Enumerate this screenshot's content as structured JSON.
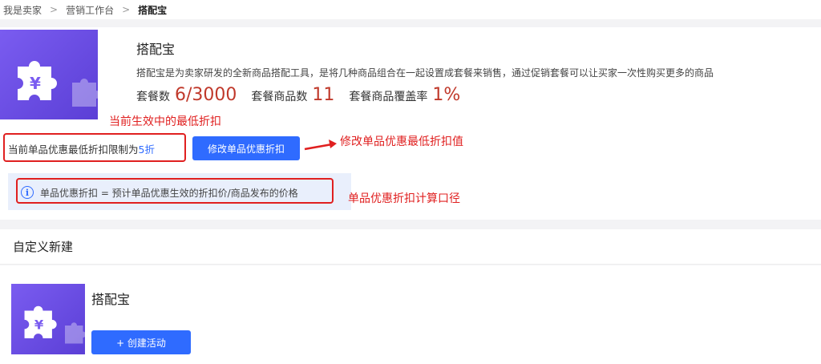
{
  "breadcrumb": {
    "items": [
      "我是卖家",
      "营销工作台",
      "搭配宝"
    ],
    "separator": ">"
  },
  "product": {
    "title": "搭配宝",
    "description": "搭配宝是为卖家研发的全新商品搭配工具，是将几种商品组合在一起设置成套餐来销售，通过促销套餐可以让买家一次性购买更多的商品",
    "image_icon": "puzzle-yuan-icon",
    "stats": [
      {
        "label": "套餐数",
        "value": "6/3000"
      },
      {
        "label": "套餐商品数",
        "value": "11"
      },
      {
        "label": "套餐商品覆盖率",
        "value": "1%"
      }
    ]
  },
  "discount": {
    "limit_prefix": "当前单品优惠最低折扣限制为",
    "limit_value": "5折",
    "edit_button": "修改单品优惠折扣",
    "info_icon": "info-icon",
    "formula": "单品优惠折扣 = 预计单品优惠生效的折扣价/商品发布的价格"
  },
  "annotations": {
    "current_min": "当前生效中的最低折扣",
    "edit_min": "修改单品优惠最低折扣值",
    "formula_note": "单品优惠折扣计算口径"
  },
  "custom": {
    "section_title": "自定义新建",
    "card_title": "搭配宝",
    "create_button": "+ 创建活动"
  },
  "colors": {
    "accent": "#2f6bff",
    "annotation": "#e02020",
    "stat_value": "#c0392b",
    "image_gradient": [
      "#7a5cf0",
      "#5b3fd6"
    ]
  }
}
